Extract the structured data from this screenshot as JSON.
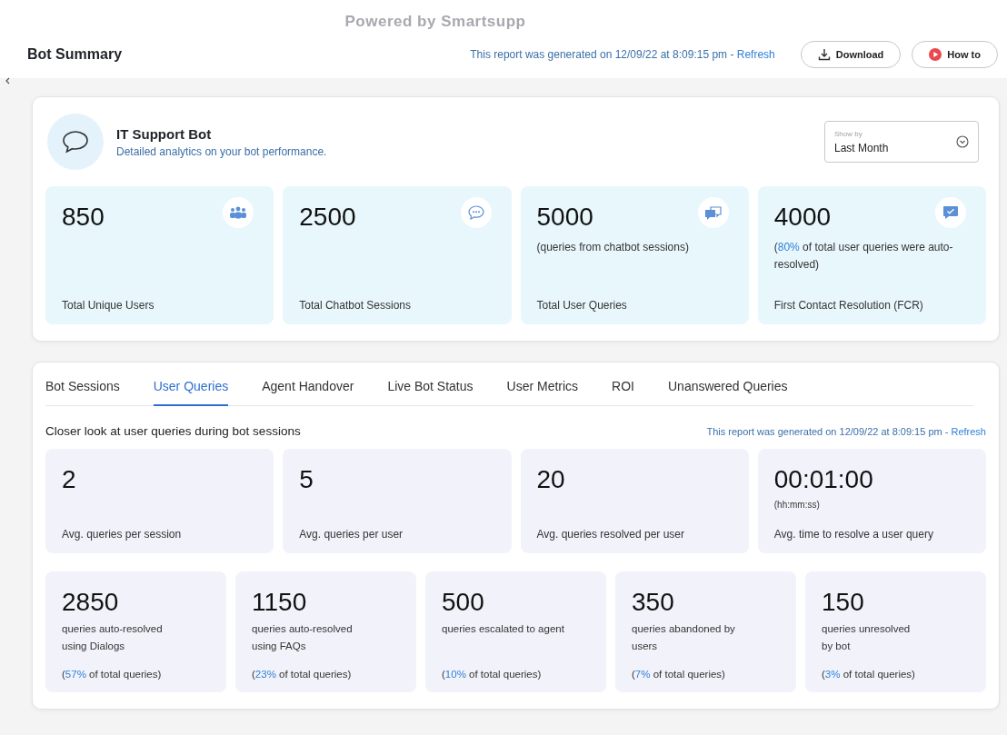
{
  "banner": "Powered by Smartsupp",
  "header": {
    "title": "Bot Summary",
    "report_note": {
      "text": "This report was generated on 12/09/22 at 8:09:15 pm - ",
      "link": "Refresh"
    },
    "buttons": [
      {
        "label": "Download",
        "kind": "download"
      },
      {
        "label": "How to",
        "kind": "video"
      }
    ]
  },
  "bot": {
    "name": "IT Support Bot",
    "subtitle": "Detailed analytics on your bot performance.",
    "show_by": {
      "label": "Show by",
      "value": "Last Month"
    }
  },
  "summary_stats": [
    {
      "value": "850",
      "label": "Total Unique Users"
    },
    {
      "value": "2500",
      "label": "Total Chatbot Sessions"
    },
    {
      "value": "5000",
      "note": {
        "text": "(queries from chatbot sessions)"
      },
      "label": "Total User Queries"
    },
    {
      "value": "4000",
      "note": {
        "open": "(",
        "highlight": "80%",
        "text": " of total user queries were auto-resolved)"
      },
      "label": "First Contact Resolution (FCR)"
    }
  ],
  "tabs": [
    {
      "label": "Bot Sessions",
      "selected": false
    },
    {
      "label": "User Queries",
      "selected": true
    },
    {
      "label": "Agent Handover",
      "selected": false
    },
    {
      "label": "Live Bot Status",
      "selected": false
    },
    {
      "label": "User Metrics",
      "selected": false
    },
    {
      "label": "ROI",
      "selected": false
    },
    {
      "label": "Unanswered Queries",
      "selected": false
    }
  ],
  "section": {
    "title": "Closer look at user queries during bot sessions",
    "report_note": {
      "text": "This report was generated on 12/09/22 at 8:09:15 pm - ",
      "link": "Refresh"
    }
  },
  "avg_stats": [
    {
      "value": "2",
      "label": "Avg. queries per session"
    },
    {
      "value": "5",
      "label": "Avg. queries per user"
    },
    {
      "value": "20",
      "label": "Avg. queries resolved per user"
    },
    {
      "value": "00:01:00",
      "unit": "(hh:mm:ss)",
      "label": "Avg. time to resolve a user query"
    }
  ],
  "breakdown": [
    {
      "value": "2850",
      "description": [
        "queries auto-resolved",
        "using Dialogs"
      ],
      "share": {
        "open": "(",
        "highlight": "57%",
        "text": " of total queries)"
      }
    },
    {
      "value": "1150",
      "description": [
        "queries auto-resolved",
        "using FAQs"
      ],
      "share": {
        "open": "(",
        "highlight": "23%",
        "text": " of total queries)"
      }
    },
    {
      "value": "500",
      "description": [
        "queries escalated to agent"
      ],
      "share": {
        "open": "(",
        "highlight": "10%",
        "text": " of total queries)"
      }
    },
    {
      "value": "350",
      "description": [
        "queries abandoned by",
        "users"
      ],
      "share": {
        "open": "(",
        "highlight": "7%",
        "text": " of total queries)"
      }
    },
    {
      "value": "150",
      "description": [
        "queries unresolved",
        "by bot"
      ],
      "share": {
        "open": "(",
        "highlight": "3%",
        "text": " of total queries)"
      }
    }
  ]
}
